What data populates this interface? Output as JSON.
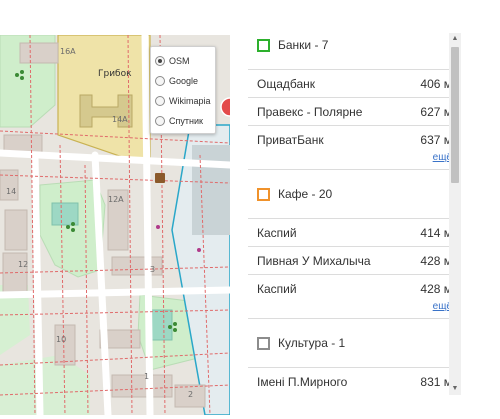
{
  "map": {
    "building_numbers": [
      "16А",
      "14А",
      "12А",
      "14",
      "12",
      "3",
      "10",
      "1",
      "2"
    ],
    "building_name": "Грибок",
    "layers": [
      {
        "label": "OSM",
        "selected": true
      },
      {
        "label": "Google",
        "selected": false
      },
      {
        "label": "Wikimapia",
        "selected": false
      },
      {
        "label": "Спутник",
        "selected": false
      }
    ]
  },
  "categories": [
    {
      "title": "Банки - 7",
      "color": "#2db02d",
      "places": [
        {
          "name": "Ощадбанк",
          "distance": "406 м"
        },
        {
          "name": "Правекс - Полярне",
          "distance": "627 м"
        },
        {
          "name": "ПриватБанк",
          "distance": "637 м"
        }
      ],
      "more": "ещё"
    },
    {
      "title": "Кафе - 20",
      "color": "#f0922b",
      "places": [
        {
          "name": "Каспий",
          "distance": "414 м"
        },
        {
          "name": "Пивная У Михалыча",
          "distance": "428 м"
        },
        {
          "name": "Каспий",
          "distance": "428 м"
        }
      ],
      "more": "ещё"
    },
    {
      "title": "Культура - 1",
      "color": "#8c8c8c",
      "places": [
        {
          "name": "Імені П.Мирного",
          "distance": "831 м"
        }
      ]
    }
  ],
  "scrollbar": {
    "up_icon": "triangle-up",
    "down_icon": "triangle-down"
  }
}
